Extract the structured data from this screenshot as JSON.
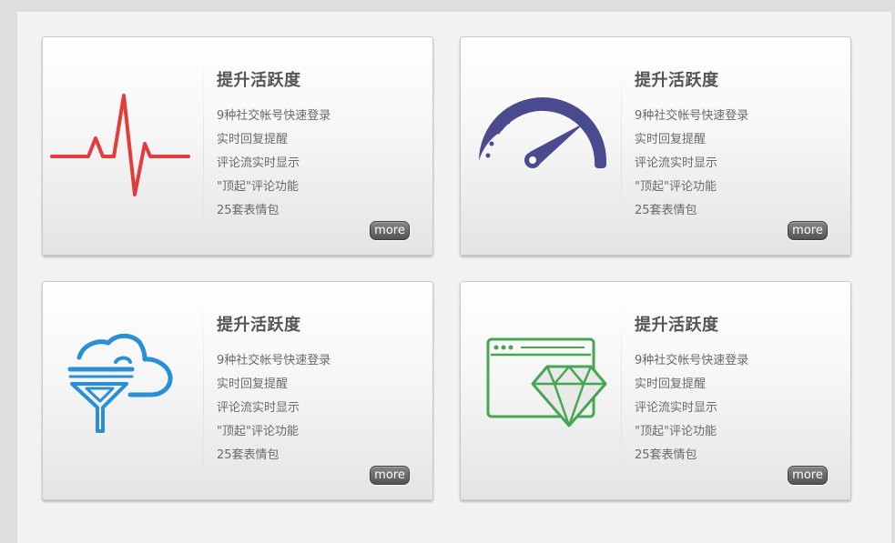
{
  "cards": [
    {
      "icon": "heartbeat-icon",
      "icon_color": "#e23d3d",
      "title": "提升活跃度",
      "features": [
        "9种社交帐号快速登录",
        "实时回复提醒",
        "评论流实时显示",
        "\"顶起\"评论功能",
        "25套表情包"
      ],
      "more_label": "more"
    },
    {
      "icon": "speedometer-icon",
      "icon_color": "#4a4a8e",
      "title": "提升活跃度",
      "features": [
        "9种社交帐号快速登录",
        "实时回复提醒",
        "评论流实时显示",
        "\"顶起\"评论功能",
        "25套表情包"
      ],
      "more_label": "more"
    },
    {
      "icon": "cloud-filter-icon",
      "icon_color": "#2a8fd4",
      "title": "提升活跃度",
      "features": [
        "9种社交帐号快速登录",
        "实时回复提醒",
        "评论流实时显示",
        "\"顶起\"评论功能",
        "25套表情包"
      ],
      "more_label": "more"
    },
    {
      "icon": "browser-diamond-icon",
      "icon_color": "#46a652",
      "title": "提升活跃度",
      "features": [
        "9种社交帐号快速登录",
        "实时回复提醒",
        "评论流实时显示",
        "\"顶起\"评论功能",
        "25套表情包"
      ],
      "more_label": "more"
    }
  ]
}
